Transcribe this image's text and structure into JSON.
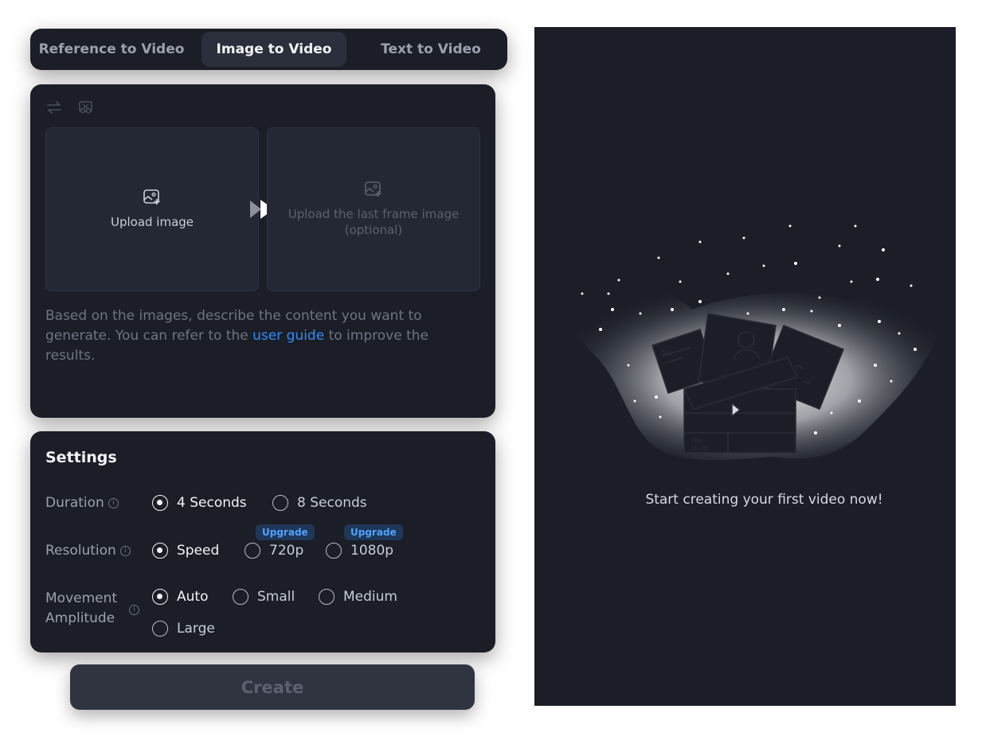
{
  "tabs": [
    {
      "label": "Reference to Video",
      "active": false
    },
    {
      "label": "Image to Video",
      "active": true
    },
    {
      "label": "Text to Video",
      "active": false
    }
  ],
  "upload": {
    "first_label": "Upload image",
    "last_label_line1": "Upload the last frame image",
    "last_label_line2": "(optional)",
    "icons": [
      "swap-icon",
      "crop-icon",
      "image-add-icon",
      "arrow-forward-icon"
    ]
  },
  "prompt": {
    "text_before": "Based on the images, describe the content you want to generate. You can refer to the ",
    "link": "user guide",
    "text_after": " to improve the results."
  },
  "settings": {
    "title": "Settings",
    "duration": {
      "label": "Duration",
      "options": [
        "4 Seconds",
        "8 Seconds"
      ],
      "selected": "4 Seconds"
    },
    "resolution": {
      "label": "Resolution",
      "options": [
        "Speed",
        "720p",
        "1080p"
      ],
      "selected": "Speed",
      "badges": [
        "Upgrade",
        "Upgrade"
      ]
    },
    "movement": {
      "label_line1": "Movement",
      "label_line2": "Amplitude",
      "options": [
        "Auto",
        "Small",
        "Medium",
        "Large"
      ],
      "selected": "Auto"
    }
  },
  "create_label": "Create",
  "preview": {
    "illustration_text_1": "Vidu",
    "illustration_text_2": "Studio",
    "illustration_text_3": "Aa",
    "empty_message": "Start creating your first video now!"
  },
  "colors": {
    "accent": "#2f8cff",
    "panel": "#1b1e26",
    "badge_bg": "#1f3758"
  }
}
